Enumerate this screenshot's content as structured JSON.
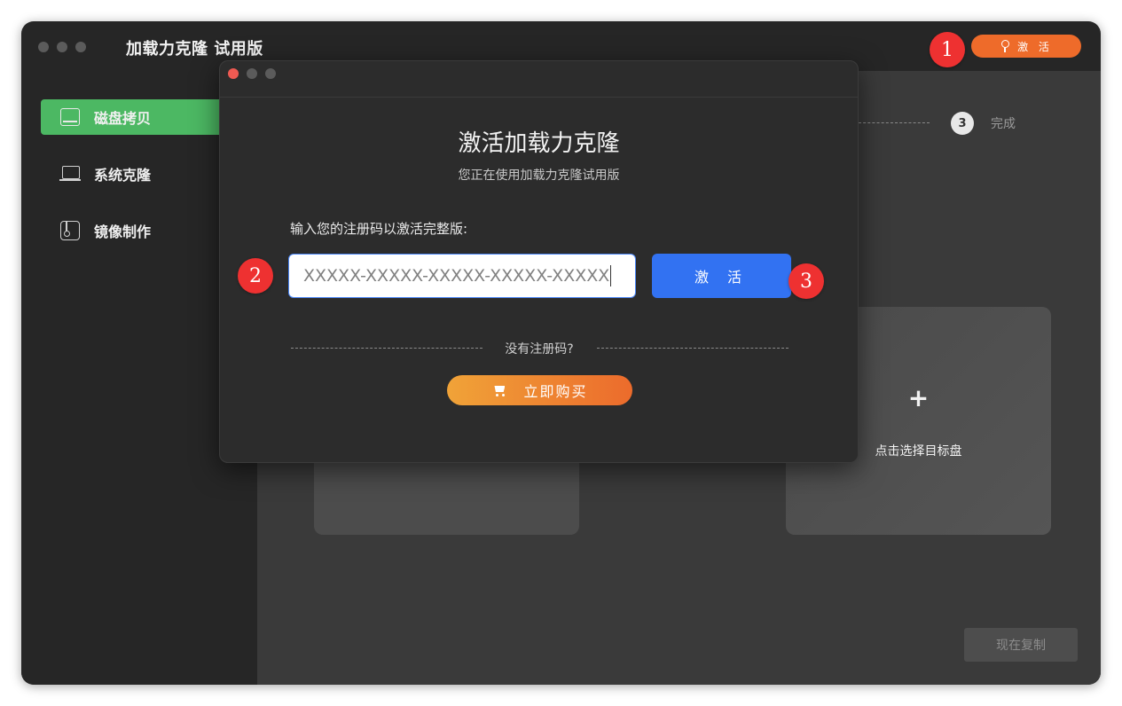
{
  "app": {
    "title": "加载力克隆 试用版",
    "activate_label": "激 活"
  },
  "sidebar": {
    "items": [
      {
        "label": "磁盘拷贝",
        "icon": "disk-icon",
        "active": true
      },
      {
        "label": "系统克隆",
        "icon": "laptop-icon",
        "active": false
      },
      {
        "label": "镜像制作",
        "icon": "image-file-icon",
        "active": false
      }
    ]
  },
  "main": {
    "step": {
      "number": "3",
      "label": "完成"
    },
    "target_card": {
      "plus": "+",
      "label": "点击选择目标盘"
    },
    "copy_button": "现在复制"
  },
  "dialog": {
    "title": "激活加载力克隆",
    "subtitle": "您正在使用加载力克隆试用版",
    "prompt": "输入您的注册码以激活完整版:",
    "code_value": "XXXXX-XXXXX-XXXXX-XXXXX-XXXXX",
    "activate_button": "激 活",
    "no_code_text": "没有注册码?",
    "buy_button": "立即购买"
  },
  "markers": [
    "1",
    "2",
    "3"
  ],
  "colors": {
    "accent_orange": "#ee6b2a",
    "active_green": "#4cb863",
    "primary_blue": "#3272f2",
    "marker_red": "#ee3131"
  }
}
